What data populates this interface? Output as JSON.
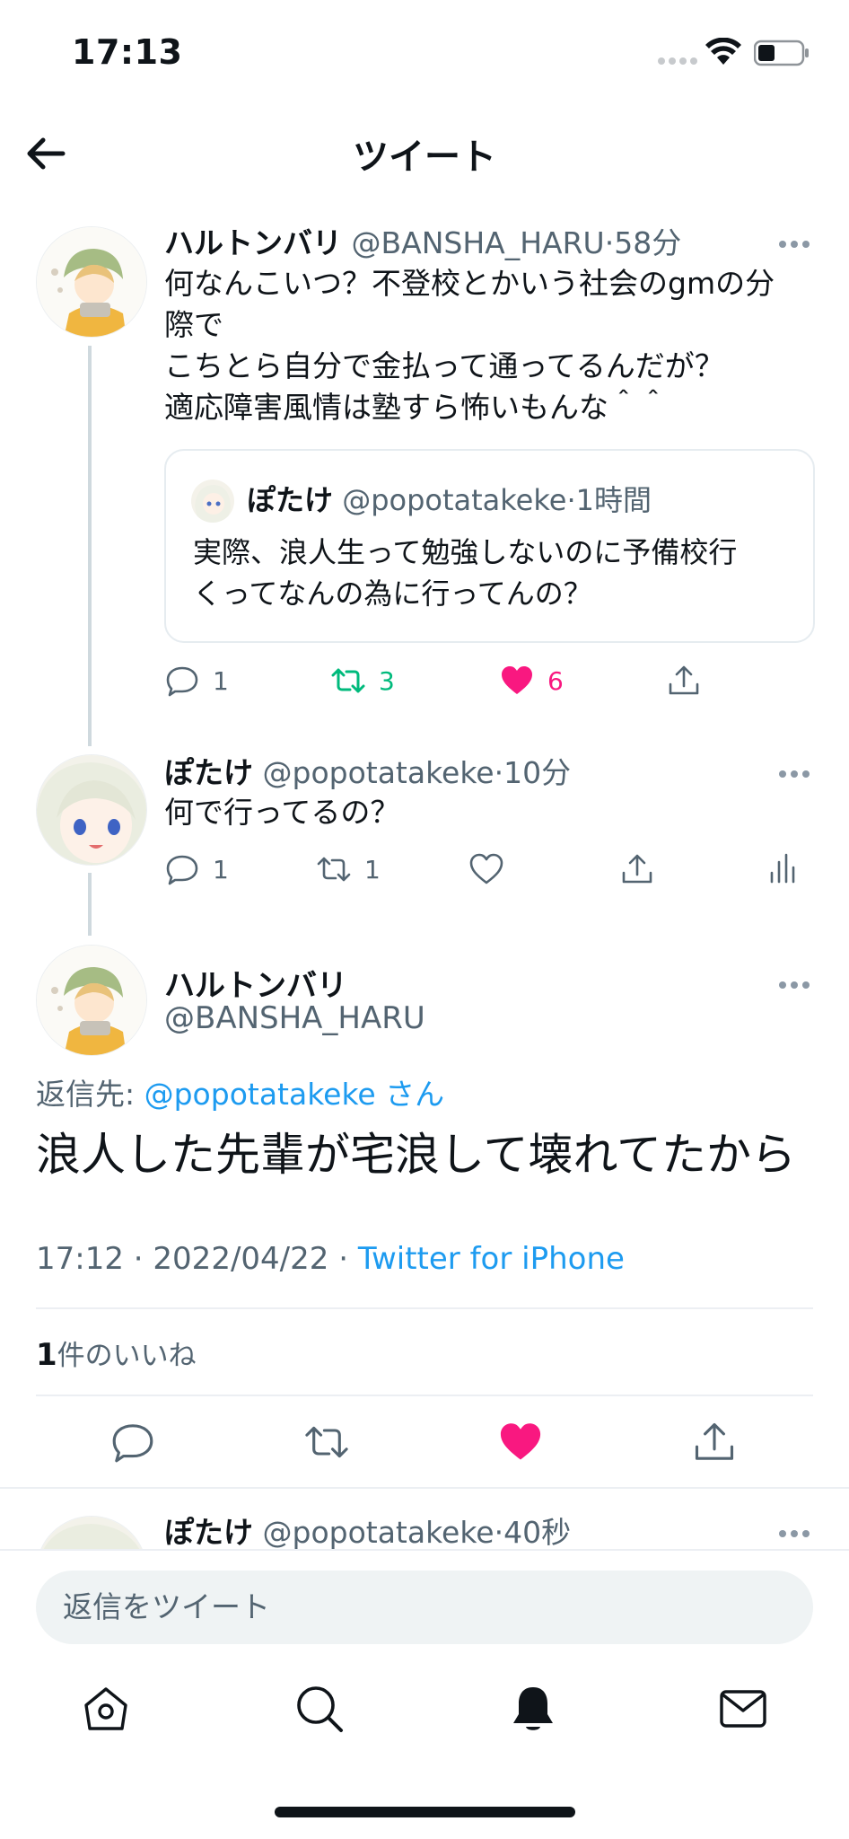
{
  "status_bar": {
    "time": "17:13"
  },
  "nav": {
    "title": "ツイート"
  },
  "tweets": [
    {
      "name": "ハルトンバリ",
      "handle": "@BANSHA_HARU",
      "separator": "·",
      "ago": "58分",
      "lines": [
        "何なんこいつ？不登校とかいう社会のgmの分",
        "際で",
        "こちとら自分で金払って通ってるんだが？",
        "適応障害風情は塾すら怖いもんな＾＾"
      ],
      "quote": {
        "name": "ぽたけ",
        "handle": "@popotatakeke",
        "separator": "·",
        "ago": "1時間",
        "lines": [
          "実際、浪人生って勉強しないのに予備校行",
          "くってなんの為に行ってんの？"
        ]
      },
      "actions": {
        "reply_count": "1",
        "retweet_count": "3",
        "like_count": "6"
      }
    },
    {
      "name": "ぽたけ",
      "handle": "@popotatakeke",
      "separator": "·",
      "ago": "10分",
      "text": "何で行ってるの？",
      "actions": {
        "reply_count": "1",
        "retweet_count": "1"
      }
    }
  ],
  "focused": {
    "name": "ハルトンバリ",
    "handle": "@BANSHA_HARU",
    "replying_prefix": "返信先: ",
    "replying_mention": "@popotatakeke",
    "replying_suffix": " さん",
    "text": "浪人した先輩が宅浪して壊れてたから",
    "time": "17:12",
    "date": "2022/04/22",
    "separator": " · ",
    "client": "Twitter for iPhone",
    "likes_count": "1",
    "likes_label": "件のいいね"
  },
  "peek_reply": {
    "name": "ぽたけ",
    "handle": "@popotatakeke",
    "separator": "·",
    "ago": "40秒"
  },
  "reply_bar": {
    "placeholder": "返信をツイート"
  },
  "colors": {
    "accent": "#1d9bf0",
    "like": "#f91880",
    "retweet": "#00ba7c",
    "text": "#0f1419",
    "muted": "#536471"
  },
  "icons": [
    "back-arrow-icon",
    "reply-icon",
    "retweet-icon",
    "like-icon",
    "share-icon",
    "analytics-icon",
    "more-icon",
    "home-icon",
    "search-icon",
    "notifications-icon",
    "messages-icon"
  ]
}
